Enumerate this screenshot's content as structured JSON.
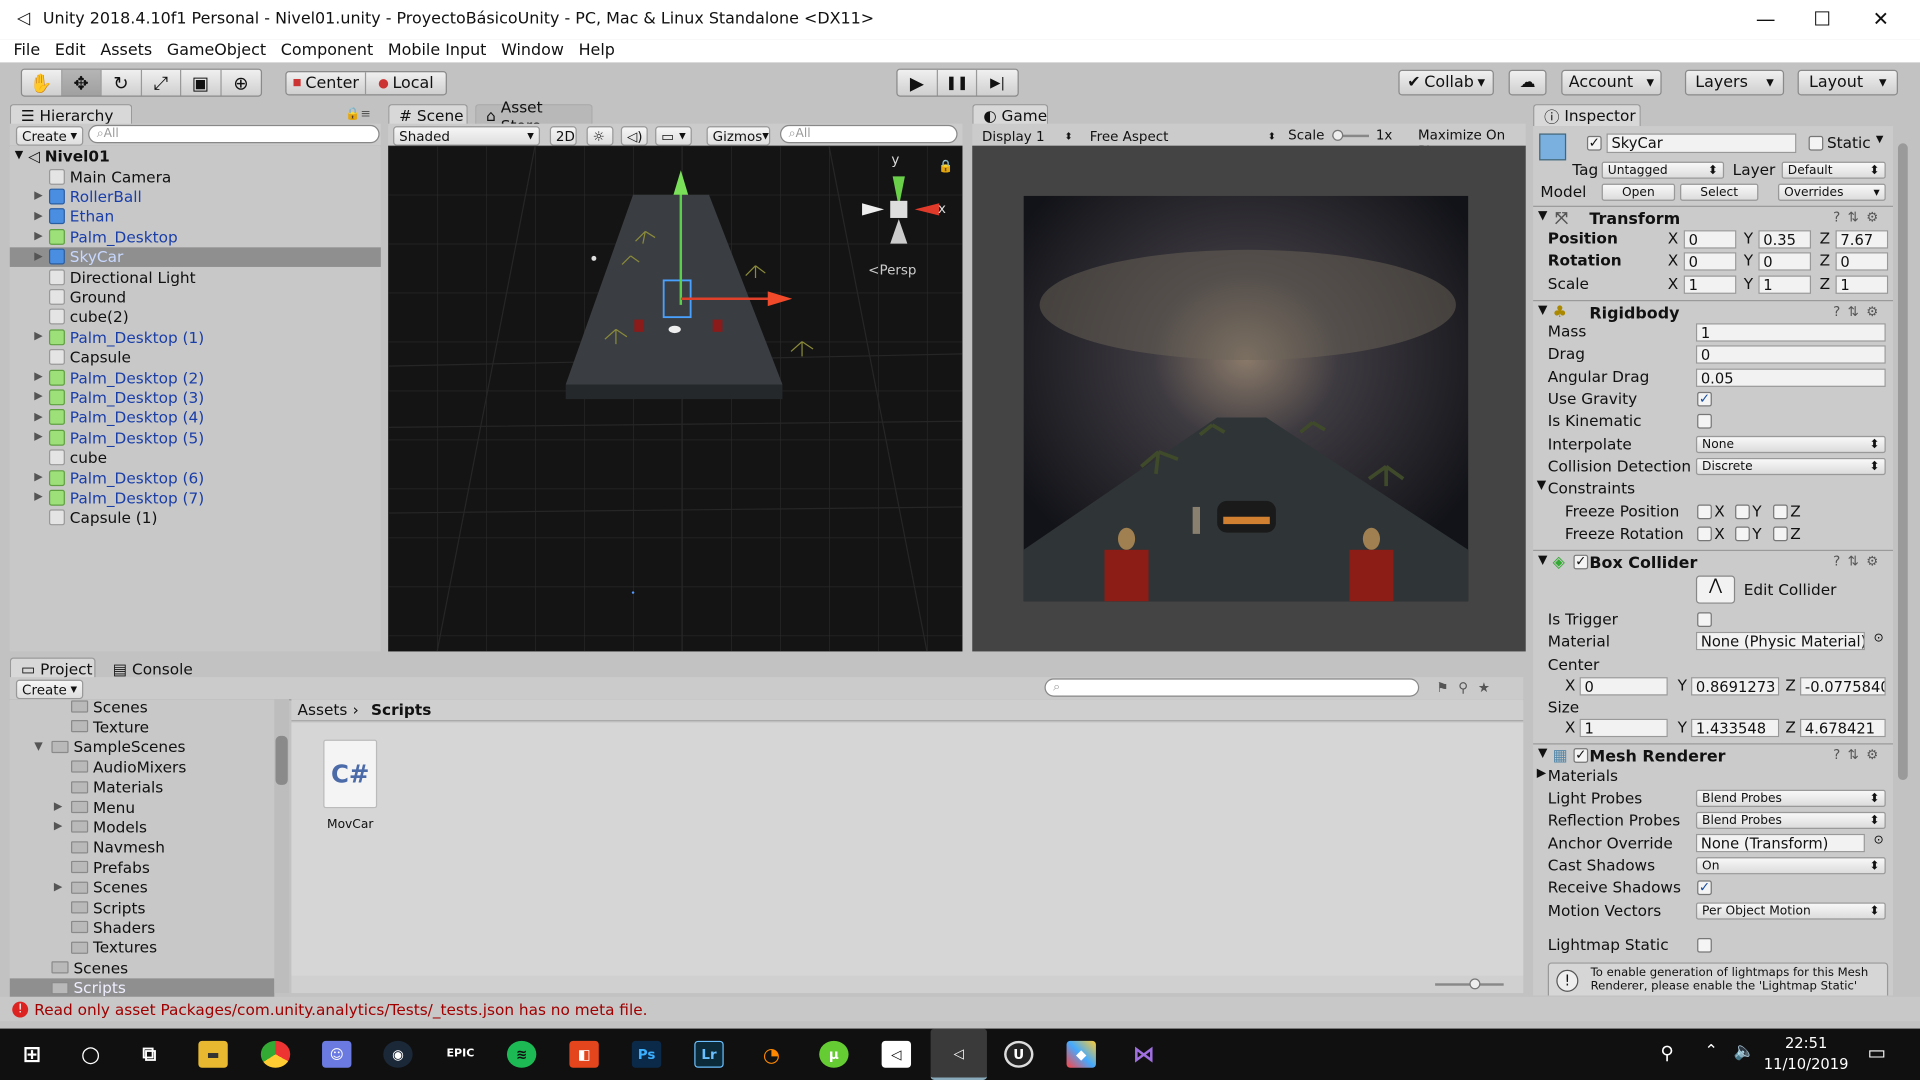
{
  "window": {
    "title": "Unity 2018.4.10f1 Personal - Nivel01.unity - ProyectoBásicoUnity - PC, Mac & Linux Standalone <DX11>",
    "min": "—",
    "max": "☐",
    "close": "✕"
  },
  "menu": [
    "File",
    "Edit",
    "Assets",
    "GameObject",
    "Component",
    "Mobile Input",
    "Window",
    "Help"
  ],
  "toolbar": {
    "center": "Center",
    "local": "Local",
    "collab": "Collab",
    "account": "Account",
    "layers": "Layers",
    "layout": "Layout",
    "play": "▶",
    "pause": "❚❚",
    "step": "▶|"
  },
  "hierarchy": {
    "tab": "Hierarchy",
    "create": "Create",
    "search": "All",
    "scene": "Nivel01",
    "items": [
      {
        "name": "Main Camera",
        "type": "cube"
      },
      {
        "name": "RollerBall",
        "type": "pref"
      },
      {
        "name": "Ethan",
        "type": "pref"
      },
      {
        "name": "Palm_Desktop",
        "type": "palm"
      },
      {
        "name": "SkyCar",
        "type": "pref"
      },
      {
        "name": "Directional Light",
        "type": "cube"
      },
      {
        "name": "Ground",
        "type": "cube"
      },
      {
        "name": "cube(2)",
        "type": "cube"
      },
      {
        "name": "Palm_Desktop (1)",
        "type": "palm"
      },
      {
        "name": "Capsule",
        "type": "cube"
      },
      {
        "name": "Palm_Desktop (2)",
        "type": "palm"
      },
      {
        "name": "Palm_Desktop (3)",
        "type": "palm"
      },
      {
        "name": "Palm_Desktop (4)",
        "type": "palm"
      },
      {
        "name": "Palm_Desktop (5)",
        "type": "palm"
      },
      {
        "name": "cube",
        "type": "cube"
      },
      {
        "name": "Palm_Desktop (6)",
        "type": "palm"
      },
      {
        "name": "Palm_Desktop (7)",
        "type": "palm"
      },
      {
        "name": "Capsule (1)",
        "type": "cube"
      }
    ]
  },
  "scene": {
    "tab": "Scene",
    "assetstore": "Asset Store",
    "shading": "Shaded",
    "mode2d": "2D",
    "gizmos": "Gizmos",
    "search": "All",
    "persp": "<Persp",
    "axis_y": "y",
    "axis_x": "x"
  },
  "game": {
    "tab": "Game",
    "display": "Display 1",
    "aspect": "Free Aspect",
    "scale_label": "Scale",
    "scale_val": "1x",
    "maximize": "Maximize On Play"
  },
  "inspector": {
    "tab": "Inspector",
    "object": "SkyCar",
    "static": "Static",
    "tag_label": "Tag",
    "tag": "Untagged",
    "layer_label": "Layer",
    "layer": "Default",
    "model_label": "Model",
    "open": "Open",
    "select": "Select",
    "overrides": "Overrides",
    "transform": {
      "title": "Transform",
      "position": "Position",
      "rotation": "Rotation",
      "scale": "Scale",
      "pos": [
        "0",
        "0.35",
        "7.67"
      ],
      "rot": [
        "0",
        "0",
        "0"
      ],
      "scl": [
        "1",
        "1",
        "1"
      ]
    },
    "rigidbody": {
      "title": "Rigidbody",
      "mass_l": "Mass",
      "mass": "1",
      "drag_l": "Drag",
      "drag": "0",
      "adrag_l": "Angular Drag",
      "adrag": "0.05",
      "grav_l": "Use Gravity",
      "kin_l": "Is Kinematic",
      "interp_l": "Interpolate",
      "interp": "None",
      "coll_l": "Collision Detection",
      "coll": "Discrete",
      "cons_l": "Constraints",
      "fpos_l": "Freeze Position",
      "frot_l": "Freeze Rotation"
    },
    "boxcollider": {
      "title": "Box Collider",
      "edit": "Edit Collider",
      "trigger_l": "Is Trigger",
      "material_l": "Material",
      "material": "None (Physic Material)",
      "center_l": "Center",
      "center": [
        "0",
        "0.8691273",
        "-0.0775840"
      ],
      "size_l": "Size",
      "size": [
        "1",
        "1.433548",
        "4.678421"
      ]
    },
    "meshrenderer": {
      "title": "Mesh Renderer",
      "materials": "Materials",
      "lp_l": "Light Probes",
      "lp": "Blend Probes",
      "rp_l": "Reflection Probes",
      "rp": "Blend Probes",
      "ao_l": "Anchor Override",
      "ao": "None (Transform)",
      "cs_l": "Cast Shadows",
      "cs": "On",
      "rs_l": "Receive Shadows",
      "mv_l": "Motion Vectors",
      "mv": "Per Object Motion",
      "ls_l": "Lightmap Static",
      "note": "To enable generation of lightmaps for this Mesh Renderer, please enable the 'Lightmap Static'"
    },
    "axes": [
      "X",
      "Y",
      "Z"
    ]
  },
  "project": {
    "tab": "Project",
    "console": "Console",
    "create": "Create",
    "breadcrumb": [
      "Assets",
      "Scripts"
    ],
    "file": "MovCar",
    "file_icon": "C#",
    "tree": [
      {
        "name": "Scenes",
        "indent": 2
      },
      {
        "name": "Texture",
        "indent": 2
      },
      {
        "name": "SampleScenes",
        "indent": 1,
        "arrow": "▼"
      },
      {
        "name": "AudioMixers",
        "indent": 2
      },
      {
        "name": "Materials",
        "indent": 2
      },
      {
        "name": "Menu",
        "indent": 2,
        "arrow": "▶"
      },
      {
        "name": "Models",
        "indent": 2,
        "arrow": "▶"
      },
      {
        "name": "Navmesh",
        "indent": 2
      },
      {
        "name": "Prefabs",
        "indent": 2
      },
      {
        "name": "Scenes",
        "indent": 2,
        "arrow": "▶"
      },
      {
        "name": "Scripts",
        "indent": 2
      },
      {
        "name": "Shaders",
        "indent": 2
      },
      {
        "name": "Textures",
        "indent": 2
      },
      {
        "name": "Scenes",
        "indent": 1
      },
      {
        "name": "Scripts",
        "indent": 1,
        "sel": true
      }
    ]
  },
  "status": "Read only asset Packages/com.unity.analytics/Tests/_tests.json has no meta file.",
  "taskbar": {
    "time": "22:51",
    "date": "11/10/2019"
  }
}
